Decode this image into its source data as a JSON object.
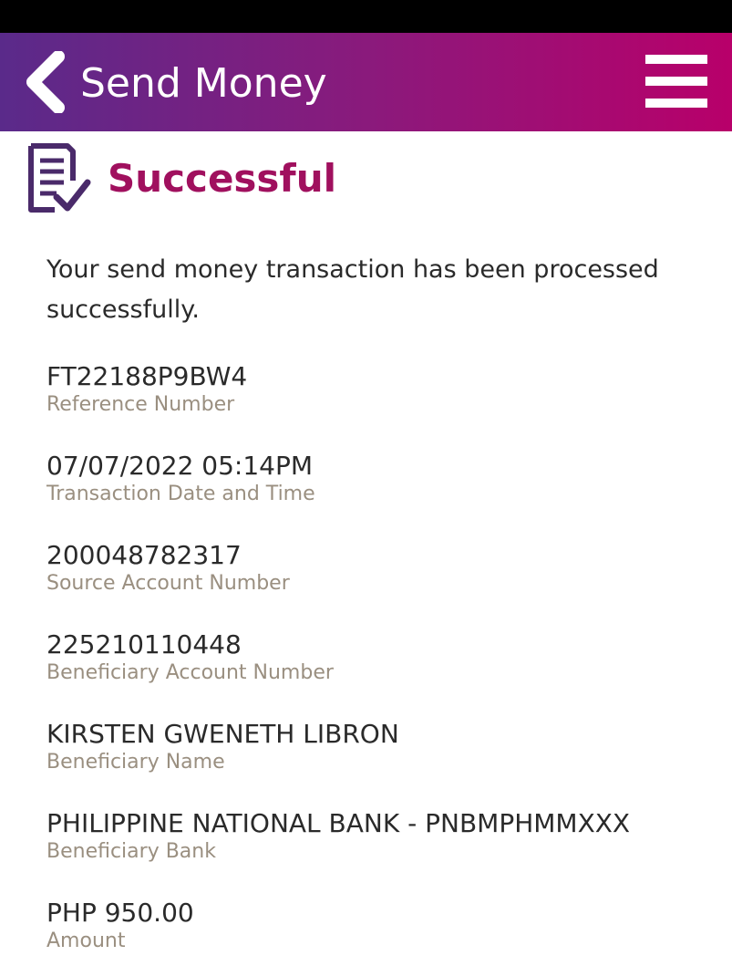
{
  "header": {
    "title": "Send Money"
  },
  "status": {
    "title": "Successful",
    "message": "Your send money transaction has been processed successfully."
  },
  "details": [
    {
      "value": "FT22188P9BW4",
      "label": "Reference Number"
    },
    {
      "value": "07/07/2022 05:14PM",
      "label": "Transaction Date and Time"
    },
    {
      "value": "200048782317",
      "label": "Source Account Number"
    },
    {
      "value": "225210110448",
      "label": "Beneficiary Account Number"
    },
    {
      "value": "KIRSTEN GWENETH LIBRON",
      "label": "Beneficiary Name"
    },
    {
      "value": "PHILIPPINE NATIONAL BANK - PNBMPHMMXXX",
      "label": "Beneficiary Bank"
    },
    {
      "value": "PHP 950.00",
      "label": "Amount"
    }
  ],
  "icons": {
    "back": "chevron-left-icon",
    "menu": "hamburger-menu-icon",
    "status": "receipt-check-icon"
  },
  "colors": {
    "header_start": "#5a2a8a",
    "header_end": "#b8006a",
    "success_title": "#a0105e",
    "icon": "#4a2a6a",
    "label": "#9a8f80"
  }
}
